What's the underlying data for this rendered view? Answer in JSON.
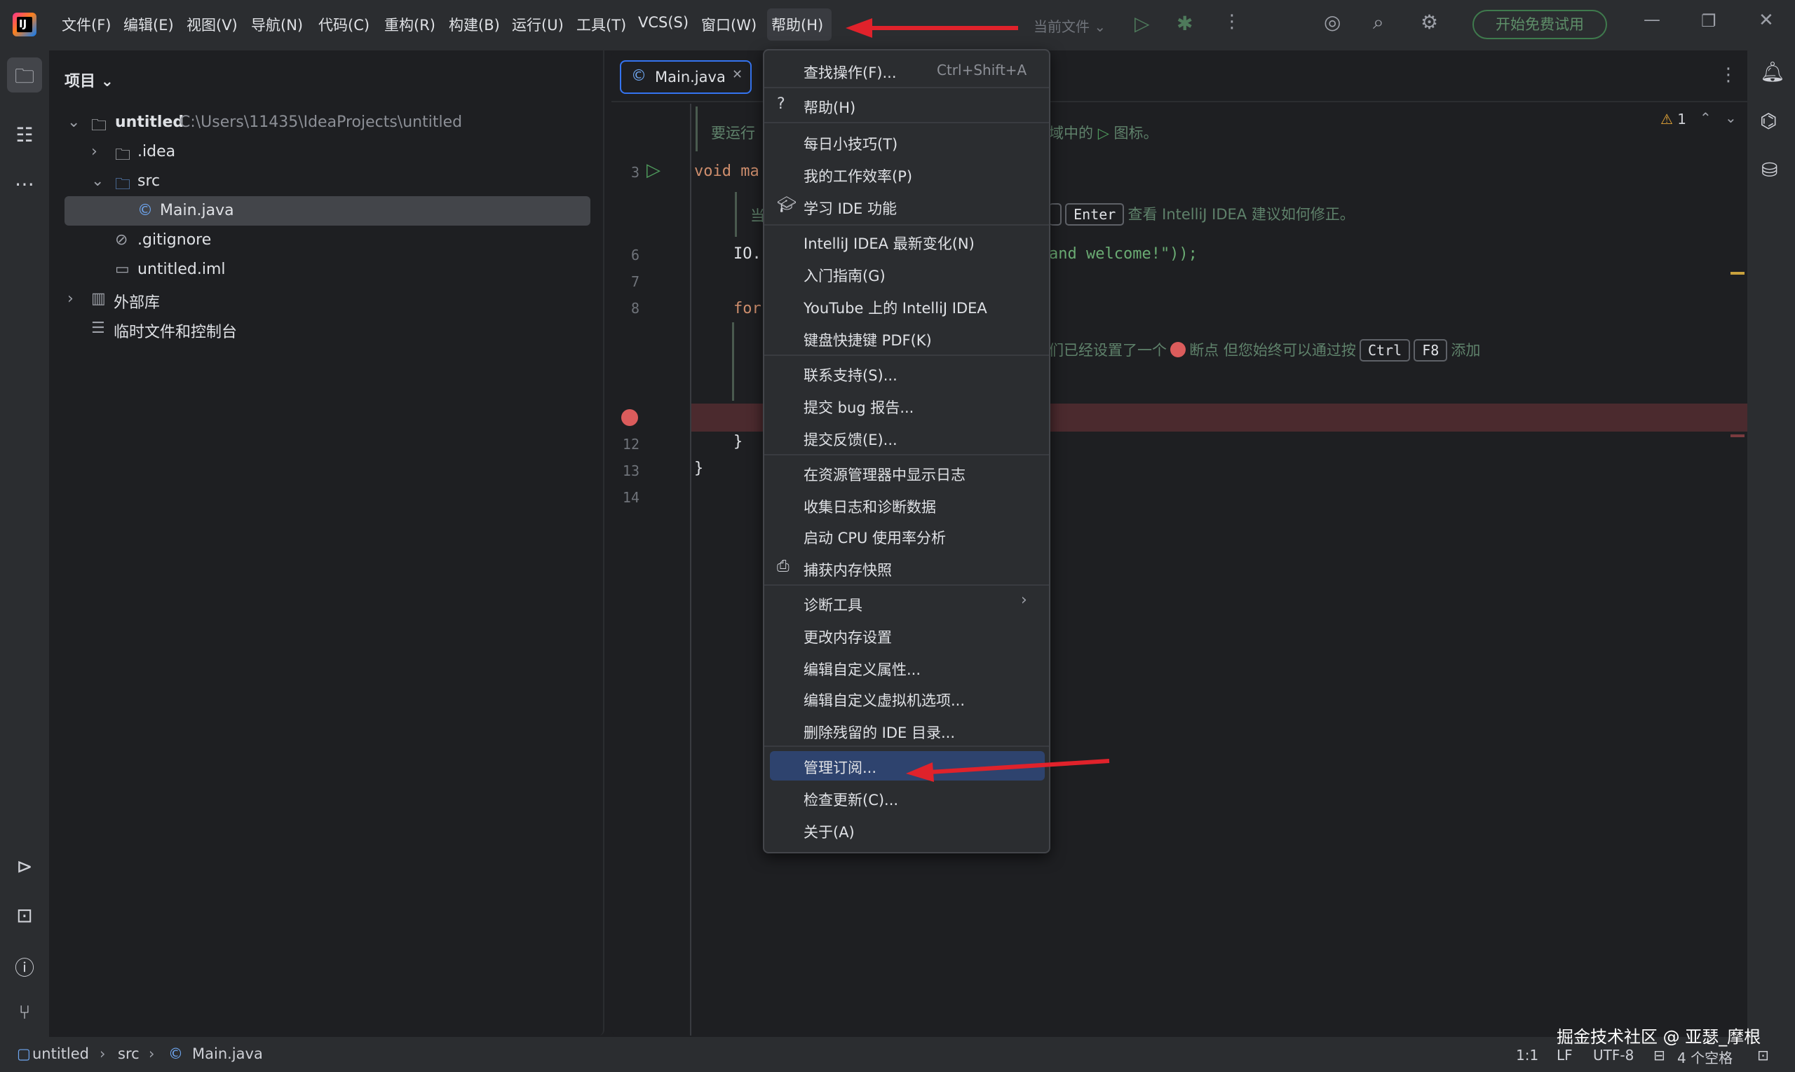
{
  "menubar": {
    "items": [
      "文件(F)",
      "编辑(E)",
      "视图(V)",
      "导航(N)",
      "代码(C)",
      "重构(R)",
      "构建(B)",
      "运行(U)",
      "工具(T)",
      "VCS(S)",
      "窗口(W)",
      "帮助(H)"
    ],
    "current_file": "当前文件",
    "trial_button": "开始免费试用"
  },
  "project_panel": {
    "title": "项目",
    "tree": {
      "root_name": "untitled",
      "root_path": "C:\\Users\\11435\\IdeaProjects\\untitled",
      "idea": ".idea",
      "src": "src",
      "main_java": "Main.java",
      "gitignore": ".gitignore",
      "iml": "untitled.iml",
      "external_libs": "外部库",
      "scratches": "临时文件和控制台"
    }
  },
  "editor": {
    "tab_label": "Main.java",
    "warning_count": "1",
    "line_numbers": [
      "3",
      "6",
      "7",
      "8",
      "12",
      "13",
      "14"
    ],
    "doc_line1_left": "要运行",
    "doc_line1_right": "域中的",
    "doc_line1_end": "图标。",
    "code_void": "void ma",
    "doc_line2_left": "当",
    "key_enter": "Enter",
    "doc_line2_right": "查看 IntelliJ IDEA 建议如何修正。",
    "code_io": "IO.",
    "code_io_right": "and welcome!\"));",
    "code_for": "for",
    "doc_line3_right1": "们已经设置了一个",
    "doc_line3_right2": "断点 但您始终可以通过按",
    "key_ctrl": "Ctrl",
    "key_f8": "F8",
    "doc_line3_right3": "添加",
    "code_brace_inner": "}",
    "code_brace_outer": "}"
  },
  "help_menu": {
    "items": [
      {
        "label": "查找操作(F)...",
        "shortcut": "Ctrl+Shift+A"
      },
      {
        "label": "帮助(H)"
      },
      {
        "label": "每日小技巧(T)"
      },
      {
        "label": "我的工作效率(P)"
      },
      {
        "label": "学习 IDE 功能"
      },
      {
        "label": "IntelliJ IDEA 最新变化(N)"
      },
      {
        "label": "入门指南(G)"
      },
      {
        "label": "YouTube 上的 IntelliJ IDEA"
      },
      {
        "label": "键盘快捷键 PDF(K)"
      },
      {
        "label": "联系支持(S)..."
      },
      {
        "label": "提交 bug 报告..."
      },
      {
        "label": "提交反馈(E)..."
      },
      {
        "label": "在资源管理器中显示日志"
      },
      {
        "label": "收集日志和诊断数据"
      },
      {
        "label": "启动 CPU 使用率分析"
      },
      {
        "label": "捕获内存快照"
      },
      {
        "label": "诊断工具"
      },
      {
        "label": "更改内存设置"
      },
      {
        "label": "编辑自定义属性..."
      },
      {
        "label": "编辑自定义虚拟机选项..."
      },
      {
        "label": "删除残留的 IDE 目录..."
      },
      {
        "label": "管理订阅..."
      },
      {
        "label": "检查更新(C)..."
      },
      {
        "label": "关于(A)"
      }
    ]
  },
  "statusbar": {
    "crumb_project": "untitled",
    "crumb_src": "src",
    "crumb_file": "Main.java",
    "position": "1:1",
    "line_sep": "LF",
    "encoding": "UTF-8",
    "indent": "4 个空格"
  },
  "watermark": "掘金技术社区 @ 亚瑟_摩根",
  "colors": {
    "accent": "#3574f0",
    "highlight": "#2e436e",
    "breakpoint": "#db5c5c",
    "annotation_arrow": "#e0222b"
  }
}
